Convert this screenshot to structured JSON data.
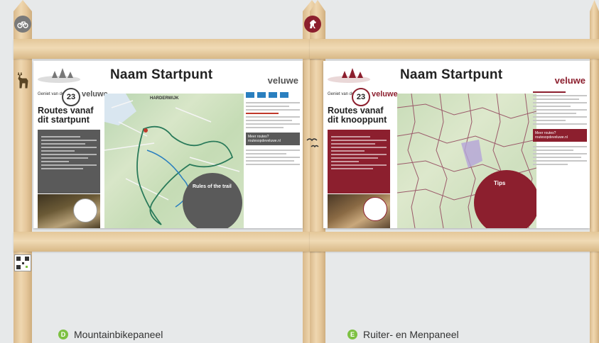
{
  "colors": {
    "mtb_accent": "#5a5a5a",
    "horse_accent": "#8c1f2e",
    "mtb_badge": "#7a7a7a",
    "horse_badge": "#8c1f2e",
    "caption_d": "#7dc142",
    "caption_e": "#7dc142"
  },
  "icons": {
    "mtb_badge": "bicycle-icon",
    "horse_badge": "horse-icon",
    "deer": "deer-icon",
    "birds": "birds-icon",
    "qr": "qr-code-icon"
  },
  "panels": [
    {
      "title": "Naam Startpunt",
      "tagline": "Geniet van de",
      "number": "23",
      "brand": "veluwe",
      "heading": "Routes vanaf dit startpunt",
      "map_label": "HARDERWIJK",
      "box_title": "Rules of the trail",
      "more_link": "Meer routes? routesopdeveluwe.nl"
    },
    {
      "title": "Naam Startpunt",
      "tagline": "Geniet van de",
      "number": "23",
      "brand": "veluwe",
      "heading": "Routes vanaf dit knooppunt",
      "tips_title": "Tips",
      "more_link": "Meer routes? routesopdeveluwe.nl"
    }
  ],
  "captions": [
    {
      "letter": "D",
      "label": "Mountainbikepaneel"
    },
    {
      "letter": "E",
      "label": "Ruiter- en Menpaneel"
    }
  ]
}
